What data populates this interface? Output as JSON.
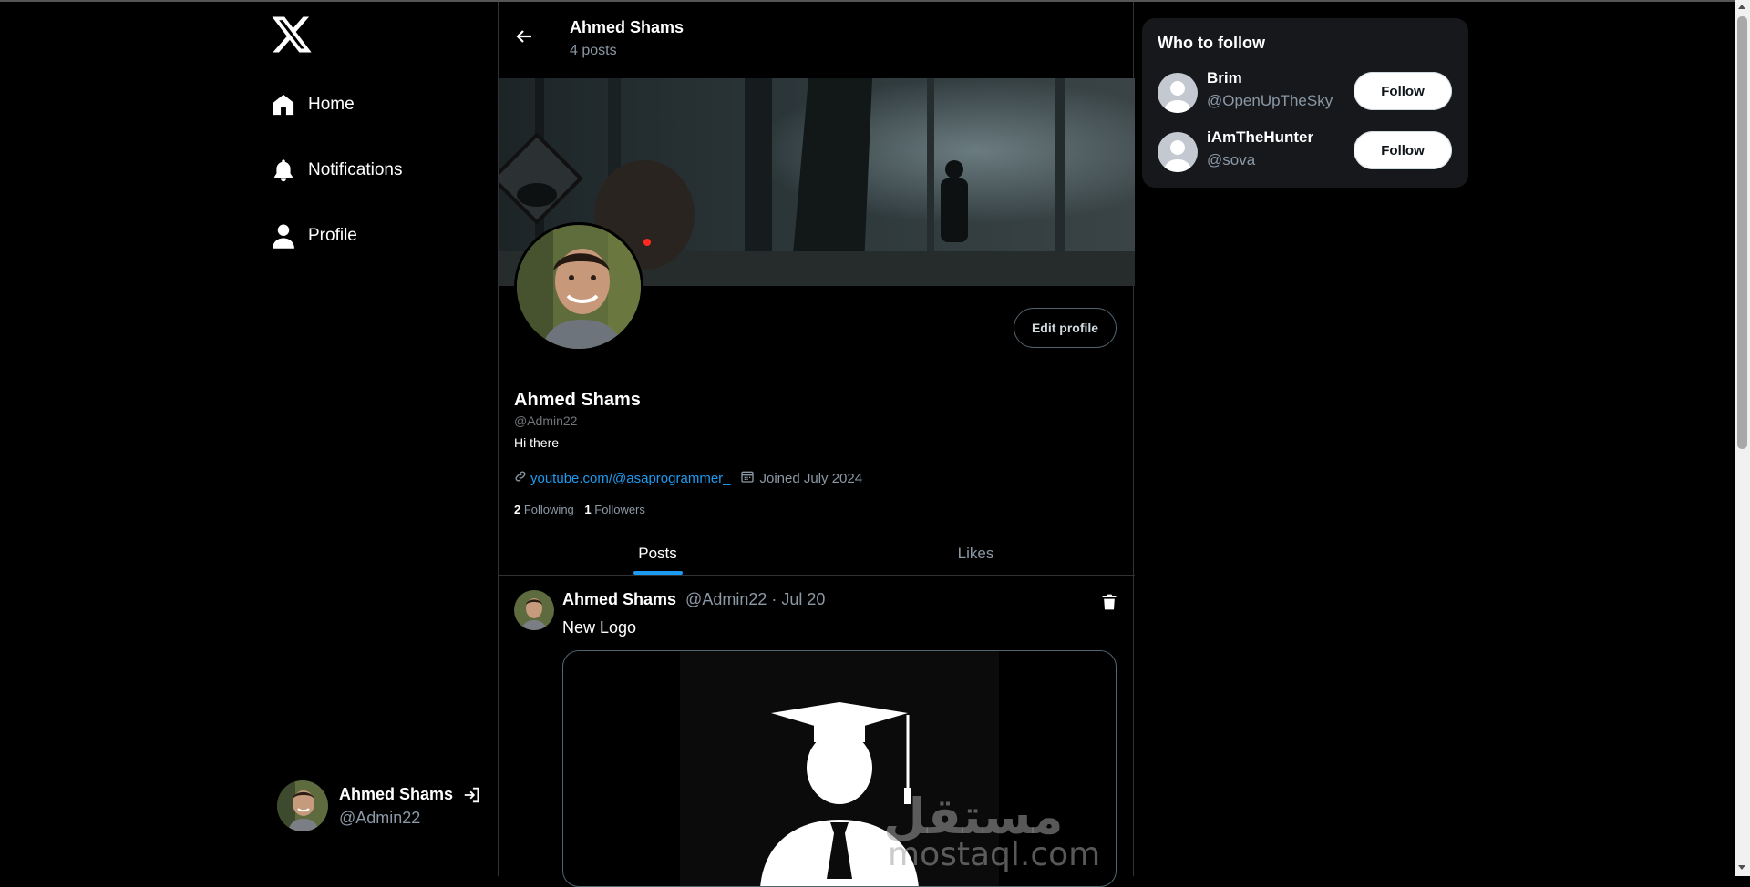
{
  "app": {
    "brand": "X"
  },
  "sidebar": {
    "items": [
      {
        "label": "Home",
        "icon": "home-icon"
      },
      {
        "label": "Notifications",
        "icon": "bell-icon"
      },
      {
        "label": "Profile",
        "icon": "user-icon"
      }
    ],
    "account": {
      "name": "Ahmed Shams",
      "handle": "@Admin22"
    }
  },
  "header": {
    "title": "Ahmed Shams",
    "subtitle": "4 posts"
  },
  "profile": {
    "name": "Ahmed Shams",
    "handle": "@Admin22",
    "bio": "Hi there",
    "link": "youtube.com/@asaprogrammer_",
    "joined": "Joined July 2024",
    "following_count": "2",
    "following_label": "Following",
    "followers_count": "1",
    "followers_label": "Followers",
    "edit_label": "Edit profile"
  },
  "tabs": [
    {
      "label": "Posts",
      "active": true
    },
    {
      "label": "Likes",
      "active": false
    }
  ],
  "post": {
    "author": "Ahmed Shams",
    "meta": "@Admin22 · Jul 20",
    "text": "New Logo",
    "watermark_ar": "مستقل",
    "watermark_en": "mostaql.com"
  },
  "who_to_follow": {
    "title": "Who to follow",
    "users": [
      {
        "name": "Brim",
        "handle": "@OpenUpTheSky",
        "button": "Follow"
      },
      {
        "name": "iAmTheHunter",
        "handle": "@sova",
        "button": "Follow"
      }
    ]
  },
  "colors": {
    "accent": "#1d9bf0",
    "background": "#000000",
    "panel": "#16181c"
  }
}
